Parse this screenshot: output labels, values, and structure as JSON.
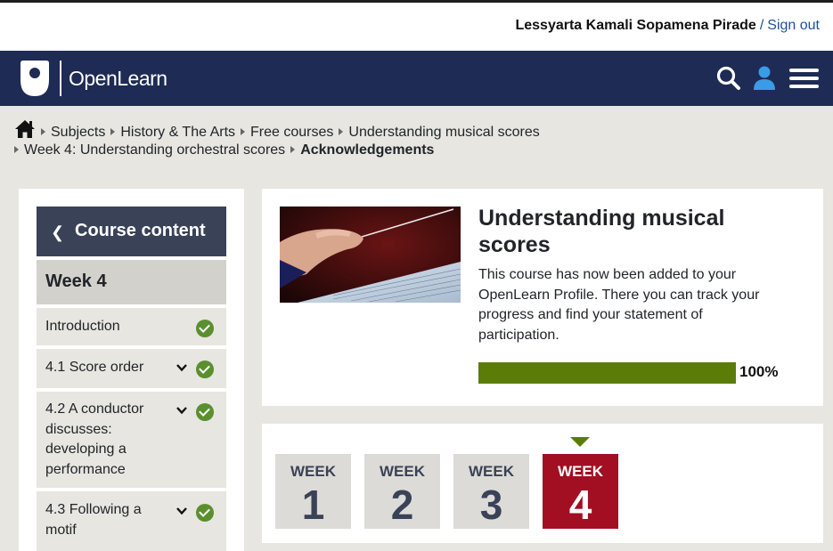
{
  "user": {
    "name": "Lessyarta Kamali Sopamena Pirade",
    "separator": "/",
    "signout": "Sign out"
  },
  "header": {
    "logo_text": "OpenLearn"
  },
  "breadcrumb": {
    "row1": [
      "Subjects",
      "History & The Arts",
      "Free courses",
      "Understanding musical scores"
    ],
    "row2_link": "Week 4: Understanding orchestral scores",
    "current": "Acknowledgements"
  },
  "sidebar": {
    "course_content": "Course content",
    "week_heading": "Week 4",
    "items": [
      {
        "label": "Introduction",
        "completed": true
      },
      {
        "label": "4.1 Score order",
        "completed": true
      },
      {
        "label": "4.2 A conductor discusses: developing a performance",
        "completed": true
      },
      {
        "label": "4.3 Following a motif",
        "completed": true
      }
    ]
  },
  "course_card": {
    "title": "Understanding musical scores",
    "body": "This course has now been added to your OpenLearn Profile. There you can track your progress and find your statement of participation.",
    "progress_value": 100,
    "progress_label": "100%"
  },
  "weeks": [
    {
      "word": "WEEK",
      "number": "1",
      "active": false
    },
    {
      "word": "WEEK",
      "number": "2",
      "active": false
    },
    {
      "word": "WEEK",
      "number": "3",
      "active": false
    },
    {
      "word": "WEEK",
      "number": "4",
      "active": true
    }
  ],
  "colors": {
    "navy": "#1e2b54",
    "panel_dark": "#3a4257",
    "progress_green": "#5a7d08",
    "check_green": "#5a8f2e",
    "active_week": "#a20e22"
  }
}
